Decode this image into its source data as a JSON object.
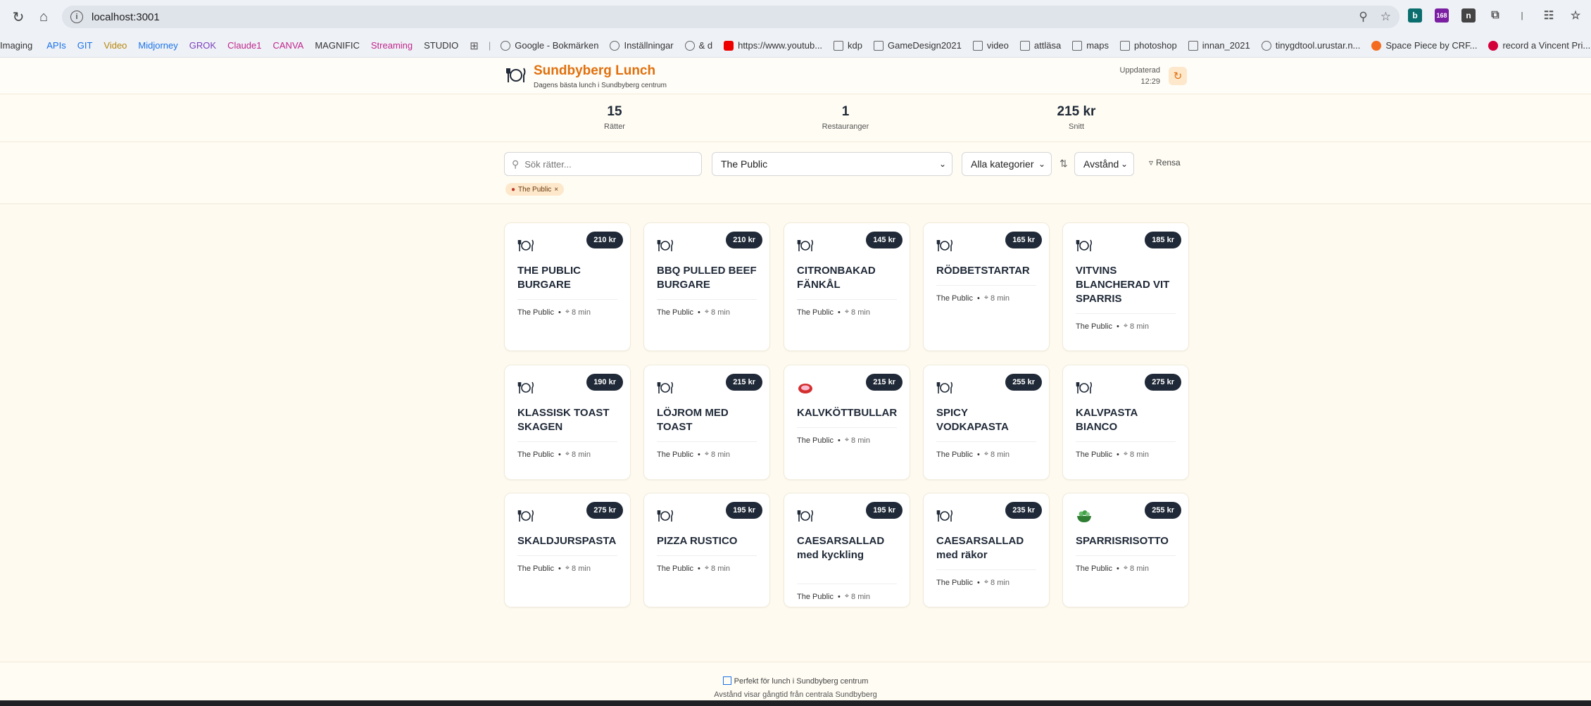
{
  "browser": {
    "url": "localhost:3001",
    "bookmarks": [
      {
        "label": "Imaging",
        "color": "#333"
      },
      {
        "label": "APIs",
        "color": "#1a73e8"
      },
      {
        "label": "GIT",
        "color": "#1a73e8"
      },
      {
        "label": "Video",
        "color": "#b8860b"
      },
      {
        "label": "Midjorney",
        "color": "#1a73e8"
      },
      {
        "label": "GROK",
        "color": "#7b3fbf"
      },
      {
        "label": "Claude1",
        "color": "#c0268c"
      },
      {
        "label": "CANVA",
        "color": "#c0268c"
      },
      {
        "label": "MAGNIFIC",
        "color": "#333"
      },
      {
        "label": "Streaming",
        "color": "#c0268c"
      },
      {
        "label": "STUDIO",
        "color": "#333"
      },
      {
        "label": "Google - Bokmärken",
        "color": "#333"
      },
      {
        "label": "Inställningar",
        "color": "#333"
      },
      {
        "label": "& d",
        "color": "#333"
      },
      {
        "label": "https://www.youtub...",
        "color": "#333"
      },
      {
        "label": "kdp",
        "color": "#333"
      },
      {
        "label": "GameDesign2021",
        "color": "#333"
      },
      {
        "label": "video",
        "color": "#333"
      },
      {
        "label": "attläsa",
        "color": "#333"
      },
      {
        "label": "maps",
        "color": "#333"
      },
      {
        "label": "photoshop",
        "color": "#333"
      },
      {
        "label": "innan_2021",
        "color": "#333"
      },
      {
        "label": "tinygdtool.urustar.n...",
        "color": "#333"
      },
      {
        "label": "Space Piece by CRF...",
        "color": "#333"
      },
      {
        "label": "record a Vincent Pri...",
        "color": "#333"
      }
    ],
    "extension_badge": "168"
  },
  "header": {
    "title": "Sundbyberg Lunch",
    "subtitle": "Dagens bästa lunch i Sundbyberg centrum",
    "updated_label": "Uppdaterad",
    "updated_time": "12:29"
  },
  "stats": [
    {
      "value": "15",
      "label": "Rätter"
    },
    {
      "value": "1",
      "label": "Restauranger"
    },
    {
      "value": "215 kr",
      "label": "Snitt"
    }
  ],
  "filters": {
    "search_placeholder": "Sök rätter...",
    "restaurant": "The Public",
    "category": "Alla kategorier",
    "sort": "Avstånd",
    "reset": "Rensa",
    "chip": "The Public"
  },
  "dishes": [
    {
      "name": "THE PUBLIC BURGARE",
      "price": "210 kr",
      "restaurant": "The Public",
      "distance": "8 min",
      "icon": "plate-icon"
    },
    {
      "name": "BBQ PULLED BEEF BURGARE",
      "price": "210 kr",
      "restaurant": "The Public",
      "distance": "8 min",
      "icon": "plate-icon"
    },
    {
      "name": "CITRONBAKAD FÄNKÅL",
      "price": "145 kr",
      "restaurant": "The Public",
      "distance": "8 min",
      "icon": "plate-icon"
    },
    {
      "name": "RÖDBETSTARTAR",
      "price": "165 kr",
      "restaurant": "The Public",
      "distance": "8 min",
      "icon": "plate-icon"
    },
    {
      "name": "VITVINS BLANCHERAD VIT SPARRIS",
      "price": "185 kr",
      "restaurant": "The Public",
      "distance": "8 min",
      "icon": "plate-icon"
    },
    {
      "name": "KLASSISK TOAST SKAGEN",
      "price": "190 kr",
      "restaurant": "The Public",
      "distance": "8 min",
      "icon": "plate-icon"
    },
    {
      "name": "LÖJROM MED TOAST",
      "price": "215 kr",
      "restaurant": "The Public",
      "distance": "8 min",
      "icon": "plate-icon"
    },
    {
      "name": "KALVKÖTTBULLAR",
      "price": "215 kr",
      "restaurant": "The Public",
      "distance": "8 min",
      "icon": "meat-icon"
    },
    {
      "name": "SPICY VODKAPASTA",
      "price": "255 kr",
      "restaurant": "The Public",
      "distance": "8 min",
      "icon": "plate-icon"
    },
    {
      "name": "KALVPASTA BIANCO",
      "price": "275 kr",
      "restaurant": "The Public",
      "distance": "8 min",
      "icon": "plate-icon"
    },
    {
      "name": "SKALDJURSPASTA",
      "price": "275 kr",
      "restaurant": "The Public",
      "distance": "8 min",
      "icon": "plate-icon"
    },
    {
      "name": "PIZZA RUSTICO",
      "price": "195 kr",
      "restaurant": "The Public",
      "distance": "8 min",
      "icon": "plate-icon"
    },
    {
      "name": "CAESARSALLAD med kyckling",
      "price": "195 kr",
      "restaurant": "The Public",
      "distance": "8 min",
      "icon": "plate-icon"
    },
    {
      "name": "CAESARSALLAD med räkor",
      "price": "235 kr",
      "restaurant": "The Public",
      "distance": "8 min",
      "icon": "plate-icon"
    },
    {
      "name": "SPARRISRISOTTO",
      "price": "255 kr",
      "restaurant": "The Public",
      "distance": "8 min",
      "icon": "salad-icon"
    }
  ],
  "footer": {
    "line1": "Perfekt för lunch i Sundbyberg centrum",
    "line2": "Avstånd visar gångtid från centrala Sundbyberg"
  },
  "colors": {
    "accent": "#e0700e",
    "price_badge": "#1f2937",
    "background": "#fefaf0"
  }
}
